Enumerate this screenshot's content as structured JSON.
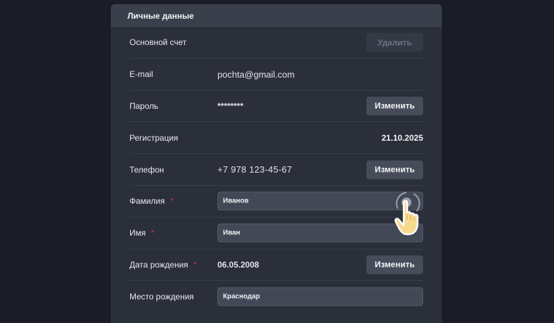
{
  "panel": {
    "title": "Личные данные"
  },
  "rows": {
    "account": {
      "label": "Основной счет",
      "button": "Удалить"
    },
    "email": {
      "label": "E-mail",
      "value": "pochta@gmail.com"
    },
    "password": {
      "label": "Пароль",
      "value": "********",
      "button": "Изменить"
    },
    "registration": {
      "label": "Регистрация",
      "value": "21.10.2025"
    },
    "phone": {
      "label": "Телефон",
      "value": "+7 978 123-45-67",
      "button": "Изменить"
    },
    "lastname": {
      "label": "Фамилия",
      "required": "*",
      "value": "Иванов"
    },
    "firstname": {
      "label": "Имя",
      "required": "*",
      "value": "Иван"
    },
    "birthdate": {
      "label": "Дата рождения",
      "required": "*",
      "value": "06.05.2008",
      "button": "Изменить"
    },
    "birthplace": {
      "label": "Место рождения",
      "value": "Краснодар"
    }
  },
  "icons": {
    "pointer": "hand-pointer-icon"
  },
  "colors": {
    "background": "#1a1c26",
    "panel": "#2b2f3a",
    "header": "#3a3f4c",
    "required": "#c2314f",
    "button": "#474c5a",
    "hand": "#f6d98c"
  }
}
